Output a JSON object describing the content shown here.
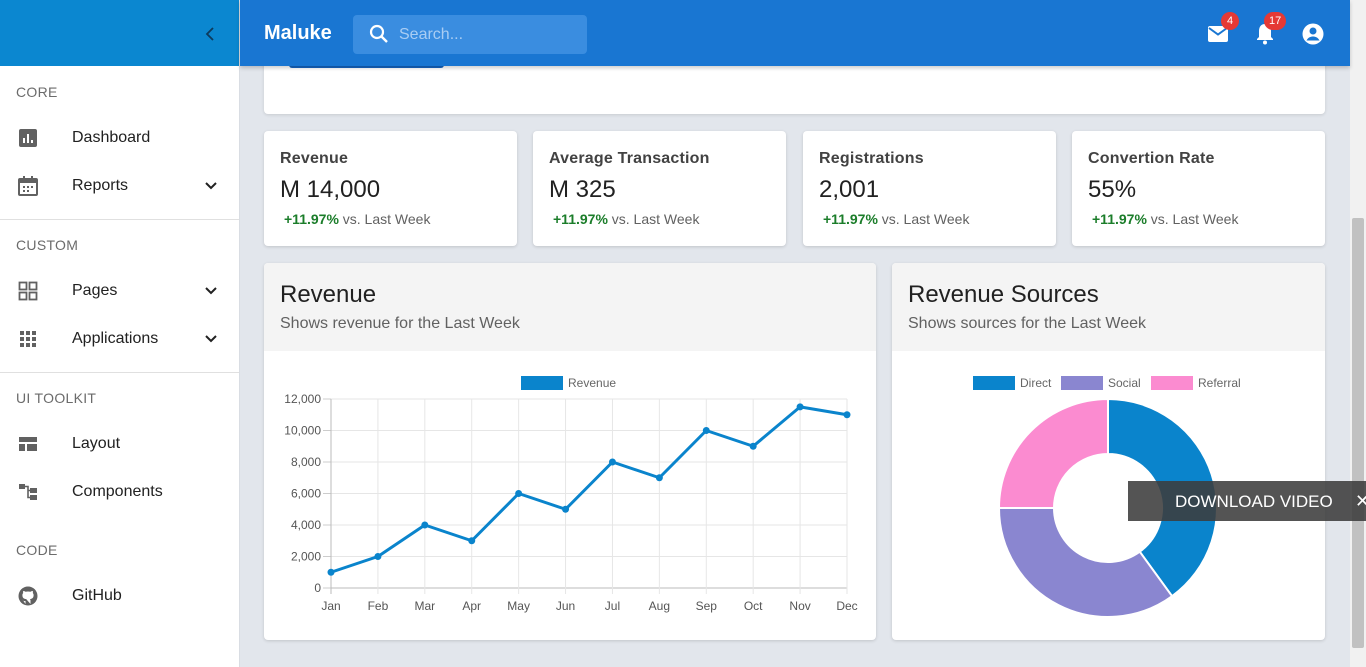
{
  "app": {
    "brand": "Maluke"
  },
  "search": {
    "placeholder": "Search..."
  },
  "header": {
    "mail_badge": "4",
    "notif_badge": "17"
  },
  "sidebar": {
    "sections": {
      "core": "CORE",
      "custom": "CUSTOM",
      "ui_toolkit": "UI TOOLKIT",
      "code": "CODE"
    },
    "items": {
      "dashboard": "Dashboard",
      "reports": "Reports",
      "pages": "Pages",
      "applications": "Applications",
      "layout": "Layout",
      "components": "Components",
      "github": "GitHub"
    }
  },
  "stats": [
    {
      "title": "Revenue",
      "value": "M 14,000",
      "change": "+11.97%",
      "suffix": "vs. Last Week"
    },
    {
      "title": "Average Transaction",
      "value": "M 325",
      "change": "+11.97%",
      "suffix": "vs. Last Week"
    },
    {
      "title": "Registrations",
      "value": "2,001",
      "change": "+11.97%",
      "suffix": "vs. Last Week"
    },
    {
      "title": "Convertion Rate",
      "value": "55%",
      "change": "+11.97%",
      "suffix": "vs. Last Week"
    }
  ],
  "revenue_card": {
    "title": "Revenue",
    "subtitle": "Shows revenue for the Last Week"
  },
  "sources_card": {
    "title": "Revenue Sources",
    "subtitle": "Shows sources for the Last Week"
  },
  "overlay": {
    "download_label": "DOWNLOAD VIDEO",
    "close": "✕"
  },
  "colors": {
    "primary": "#1976d2",
    "sidebar_top": "#0b87d0",
    "line": "#0a84cc",
    "direct": "#0a84cc",
    "social": "#8a86d0",
    "referral": "#fb8bd0",
    "positive": "#1b7d2a"
  },
  "chart_data": [
    {
      "type": "line",
      "title": "",
      "categories": [
        "Jan",
        "Feb",
        "Mar",
        "Apr",
        "May",
        "Jun",
        "Jul",
        "Aug",
        "Sep",
        "Oct",
        "Nov",
        "Dec"
      ],
      "series": [
        {
          "name": "Revenue",
          "values": [
            1000,
            2000,
            4000,
            3000,
            6000,
            5000,
            8000,
            7000,
            10000,
            9000,
            11500,
            11000
          ]
        }
      ],
      "yticks": [
        "0",
        "2,000",
        "4,000",
        "6,000",
        "8,000",
        "10,000",
        "12,000"
      ],
      "ylim": [
        0,
        12000
      ],
      "grid": true,
      "legend": "top"
    },
    {
      "type": "pie",
      "title": "",
      "categories": [
        "Direct",
        "Social",
        "Referral"
      ],
      "values": [
        40,
        35,
        25
      ],
      "legend": "top"
    }
  ]
}
